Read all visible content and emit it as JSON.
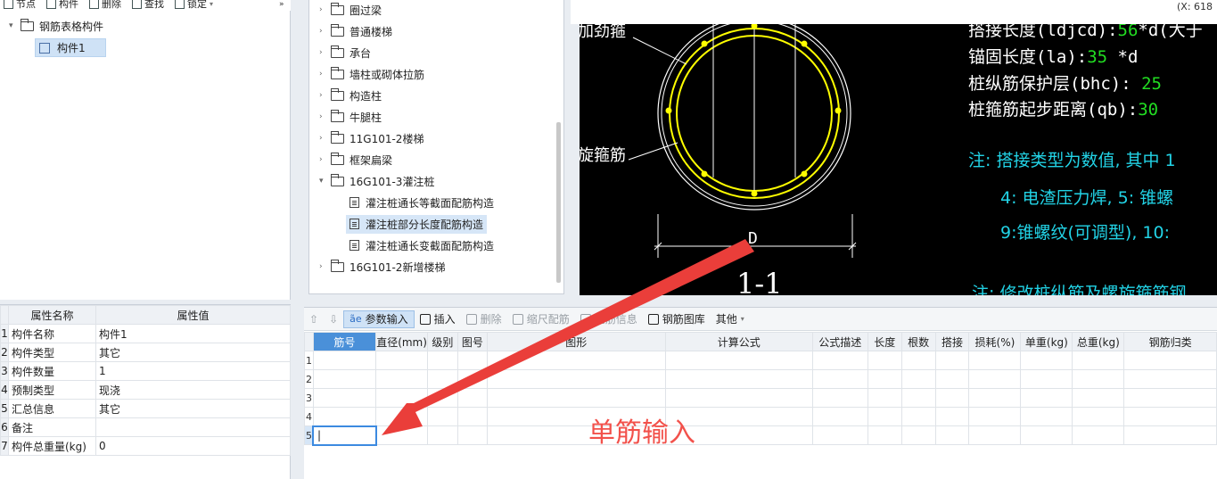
{
  "left_toolbar": {
    "items": [
      {
        "label": "节点",
        "icon": "add-node-icon"
      },
      {
        "label": "构件",
        "icon": "component-icon"
      },
      {
        "label": "删除",
        "icon": "delete-icon"
      },
      {
        "label": "查找",
        "icon": "find-icon"
      },
      {
        "label": "锁定",
        "icon": "lock-icon"
      }
    ],
    "more": "»"
  },
  "left_tree": {
    "root": "钢筋表格构件",
    "child": "构件1"
  },
  "properties": {
    "headers": [
      "属性名称",
      "属性值"
    ],
    "rows": [
      {
        "num": "1",
        "name": "构件名称",
        "value": "构件1"
      },
      {
        "num": "2",
        "name": "构件类型",
        "value": "其它"
      },
      {
        "num": "3",
        "name": "构件数量",
        "value": "1"
      },
      {
        "num": "4",
        "name": "预制类型",
        "value": "现浇"
      },
      {
        "num": "5",
        "name": "汇总信息",
        "value": "其它"
      },
      {
        "num": "6",
        "name": "备注",
        "value": ""
      },
      {
        "num": "7",
        "name": "构件总重量(kg)",
        "value": "0"
      }
    ]
  },
  "mid_tree": {
    "items": [
      {
        "label": "圈过梁",
        "type": "folder"
      },
      {
        "label": "普通楼梯",
        "type": "folder"
      },
      {
        "label": "承台",
        "type": "folder"
      },
      {
        "label": "墙柱或砌体拉筋",
        "type": "folder"
      },
      {
        "label": "构造柱",
        "type": "folder"
      },
      {
        "label": "牛腿柱",
        "type": "folder"
      },
      {
        "label": "11G101-2楼梯",
        "type": "folder"
      },
      {
        "label": "框架扁梁",
        "type": "folder"
      },
      {
        "label": "16G101-3灌注桩",
        "type": "folder-open"
      },
      {
        "label": "灌注桩通长等截面配筋构造",
        "type": "doc"
      },
      {
        "label": "灌注桩部分长度配筋构造",
        "type": "doc-selected"
      },
      {
        "label": "灌注桩通长变截面配筋构造",
        "type": "doc"
      },
      {
        "label": "16G101-2新增楼梯",
        "type": "folder"
      }
    ]
  },
  "coord_text": "(X: 618",
  "cad": {
    "labels": {
      "stiffener": "加劲箍",
      "spiral": "旋箍筋",
      "dim": "D",
      "section": "1-1"
    },
    "params": [
      {
        "text": "搭接长度(ldjcd):",
        "value": "56",
        "suffix": "*d(大于"
      },
      {
        "text": "锚固长度(la):",
        "value": "35",
        "suffix": " *d"
      },
      {
        "text": "桩纵筋保护层(bhc):",
        "value": " 25",
        "suffix": ""
      },
      {
        "text": "桩箍筋起步距离(qb):",
        "value": "30",
        "suffix": ""
      }
    ],
    "notes": [
      "注: 搭接类型为数值, 其中 1",
      "4: 电渣压力焊, 5: 锥螺",
      "9:锥螺纹(可调型), 10:",
      "注: 修改桩纵筋及螺旋箍筋钢"
    ],
    "colors": {
      "param_value": "#22dd22",
      "note": "#22d3e6",
      "rebar": "#ffff00"
    }
  },
  "bottom_toolbar": {
    "items": [
      {
        "label": "",
        "icon": "move-up-icon",
        "disabled": true
      },
      {
        "label": "",
        "icon": "move-down-icon",
        "disabled": true
      },
      {
        "label": "参数输入",
        "icon": "param-input-icon",
        "active": true
      },
      {
        "label": "插入",
        "icon": "insert-icon"
      },
      {
        "label": "删除",
        "icon": "delete-icon",
        "disabled": true
      },
      {
        "label": "缩尺配筋",
        "icon": "scale-rebar-icon",
        "disabled": true
      },
      {
        "label": "钢筋信息",
        "icon": "rebar-info-icon",
        "disabled": true
      },
      {
        "label": "钢筋图库",
        "icon": "rebar-library-icon"
      },
      {
        "label": "其他",
        "icon": "",
        "dropdown": true
      }
    ]
  },
  "grid": {
    "headers": [
      "筋号",
      "直径(mm)",
      "级别",
      "图号",
      "图形",
      "计算公式",
      "公式描述",
      "长度",
      "根数",
      "搭接",
      "损耗(%)",
      "单重(kg)",
      "总重(kg)",
      "钢筋归类"
    ],
    "rows": [
      "1",
      "2",
      "3",
      "4",
      "5"
    ],
    "editing_cell_value": "|"
  },
  "annotation": {
    "text": "单筋输入",
    "color": "#f2514b"
  }
}
